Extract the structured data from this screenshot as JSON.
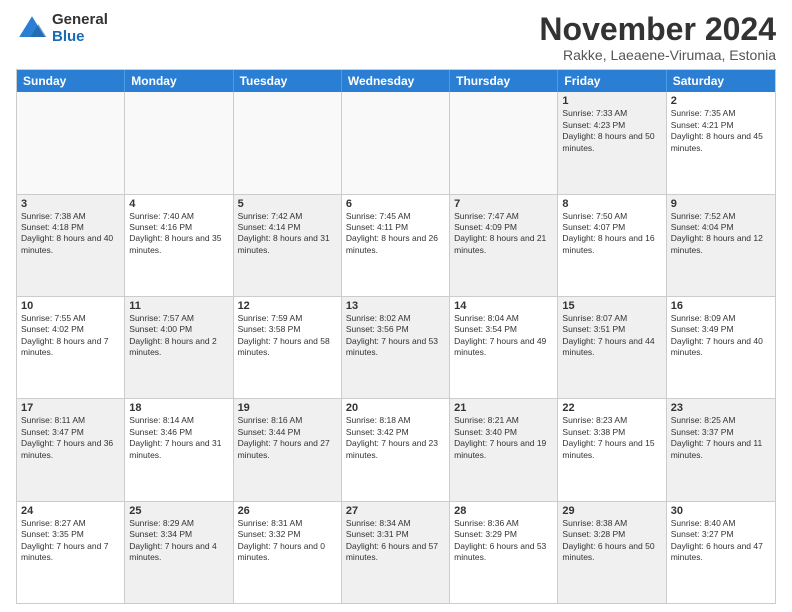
{
  "logo": {
    "general": "General",
    "blue": "Blue"
  },
  "title": "November 2024",
  "subtitle": "Rakke, Laeaene-Virumaa, Estonia",
  "days": [
    "Sunday",
    "Monday",
    "Tuesday",
    "Wednesday",
    "Thursday",
    "Friday",
    "Saturday"
  ],
  "weeks": [
    [
      {
        "day": "",
        "text": "",
        "empty": true
      },
      {
        "day": "",
        "text": "",
        "empty": true
      },
      {
        "day": "",
        "text": "",
        "empty": true
      },
      {
        "day": "",
        "text": "",
        "empty": true
      },
      {
        "day": "",
        "text": "",
        "empty": true
      },
      {
        "day": "1",
        "text": "Sunrise: 7:33 AM\nSunset: 4:23 PM\nDaylight: 8 hours and 50 minutes.",
        "shaded": true
      },
      {
        "day": "2",
        "text": "Sunrise: 7:35 AM\nSunset: 4:21 PM\nDaylight: 8 hours and 45 minutes.",
        "shaded": false
      }
    ],
    [
      {
        "day": "3",
        "text": "Sunrise: 7:38 AM\nSunset: 4:18 PM\nDaylight: 8 hours and 40 minutes.",
        "shaded": true
      },
      {
        "day": "4",
        "text": "Sunrise: 7:40 AM\nSunset: 4:16 PM\nDaylight: 8 hours and 35 minutes.",
        "shaded": false
      },
      {
        "day": "5",
        "text": "Sunrise: 7:42 AM\nSunset: 4:14 PM\nDaylight: 8 hours and 31 minutes.",
        "shaded": true
      },
      {
        "day": "6",
        "text": "Sunrise: 7:45 AM\nSunset: 4:11 PM\nDaylight: 8 hours and 26 minutes.",
        "shaded": false
      },
      {
        "day": "7",
        "text": "Sunrise: 7:47 AM\nSunset: 4:09 PM\nDaylight: 8 hours and 21 minutes.",
        "shaded": true
      },
      {
        "day": "8",
        "text": "Sunrise: 7:50 AM\nSunset: 4:07 PM\nDaylight: 8 hours and 16 minutes.",
        "shaded": false
      },
      {
        "day": "9",
        "text": "Sunrise: 7:52 AM\nSunset: 4:04 PM\nDaylight: 8 hours and 12 minutes.",
        "shaded": true
      }
    ],
    [
      {
        "day": "10",
        "text": "Sunrise: 7:55 AM\nSunset: 4:02 PM\nDaylight: 8 hours and 7 minutes.",
        "shaded": false
      },
      {
        "day": "11",
        "text": "Sunrise: 7:57 AM\nSunset: 4:00 PM\nDaylight: 8 hours and 2 minutes.",
        "shaded": true
      },
      {
        "day": "12",
        "text": "Sunrise: 7:59 AM\nSunset: 3:58 PM\nDaylight: 7 hours and 58 minutes.",
        "shaded": false
      },
      {
        "day": "13",
        "text": "Sunrise: 8:02 AM\nSunset: 3:56 PM\nDaylight: 7 hours and 53 minutes.",
        "shaded": true
      },
      {
        "day": "14",
        "text": "Sunrise: 8:04 AM\nSunset: 3:54 PM\nDaylight: 7 hours and 49 minutes.",
        "shaded": false
      },
      {
        "day": "15",
        "text": "Sunrise: 8:07 AM\nSunset: 3:51 PM\nDaylight: 7 hours and 44 minutes.",
        "shaded": true
      },
      {
        "day": "16",
        "text": "Sunrise: 8:09 AM\nSunset: 3:49 PM\nDaylight: 7 hours and 40 minutes.",
        "shaded": false
      }
    ],
    [
      {
        "day": "17",
        "text": "Sunrise: 8:11 AM\nSunset: 3:47 PM\nDaylight: 7 hours and 36 minutes.",
        "shaded": true
      },
      {
        "day": "18",
        "text": "Sunrise: 8:14 AM\nSunset: 3:46 PM\nDaylight: 7 hours and 31 minutes.",
        "shaded": false
      },
      {
        "day": "19",
        "text": "Sunrise: 8:16 AM\nSunset: 3:44 PM\nDaylight: 7 hours and 27 minutes.",
        "shaded": true
      },
      {
        "day": "20",
        "text": "Sunrise: 8:18 AM\nSunset: 3:42 PM\nDaylight: 7 hours and 23 minutes.",
        "shaded": false
      },
      {
        "day": "21",
        "text": "Sunrise: 8:21 AM\nSunset: 3:40 PM\nDaylight: 7 hours and 19 minutes.",
        "shaded": true
      },
      {
        "day": "22",
        "text": "Sunrise: 8:23 AM\nSunset: 3:38 PM\nDaylight: 7 hours and 15 minutes.",
        "shaded": false
      },
      {
        "day": "23",
        "text": "Sunrise: 8:25 AM\nSunset: 3:37 PM\nDaylight: 7 hours and 11 minutes.",
        "shaded": true
      }
    ],
    [
      {
        "day": "24",
        "text": "Sunrise: 8:27 AM\nSunset: 3:35 PM\nDaylight: 7 hours and 7 minutes.",
        "shaded": false
      },
      {
        "day": "25",
        "text": "Sunrise: 8:29 AM\nSunset: 3:34 PM\nDaylight: 7 hours and 4 minutes.",
        "shaded": true
      },
      {
        "day": "26",
        "text": "Sunrise: 8:31 AM\nSunset: 3:32 PM\nDaylight: 7 hours and 0 minutes.",
        "shaded": false
      },
      {
        "day": "27",
        "text": "Sunrise: 8:34 AM\nSunset: 3:31 PM\nDaylight: 6 hours and 57 minutes.",
        "shaded": true
      },
      {
        "day": "28",
        "text": "Sunrise: 8:36 AM\nSunset: 3:29 PM\nDaylight: 6 hours and 53 minutes.",
        "shaded": false
      },
      {
        "day": "29",
        "text": "Sunrise: 8:38 AM\nSunset: 3:28 PM\nDaylight: 6 hours and 50 minutes.",
        "shaded": true
      },
      {
        "day": "30",
        "text": "Sunrise: 8:40 AM\nSunset: 3:27 PM\nDaylight: 6 hours and 47 minutes.",
        "shaded": false
      }
    ]
  ]
}
